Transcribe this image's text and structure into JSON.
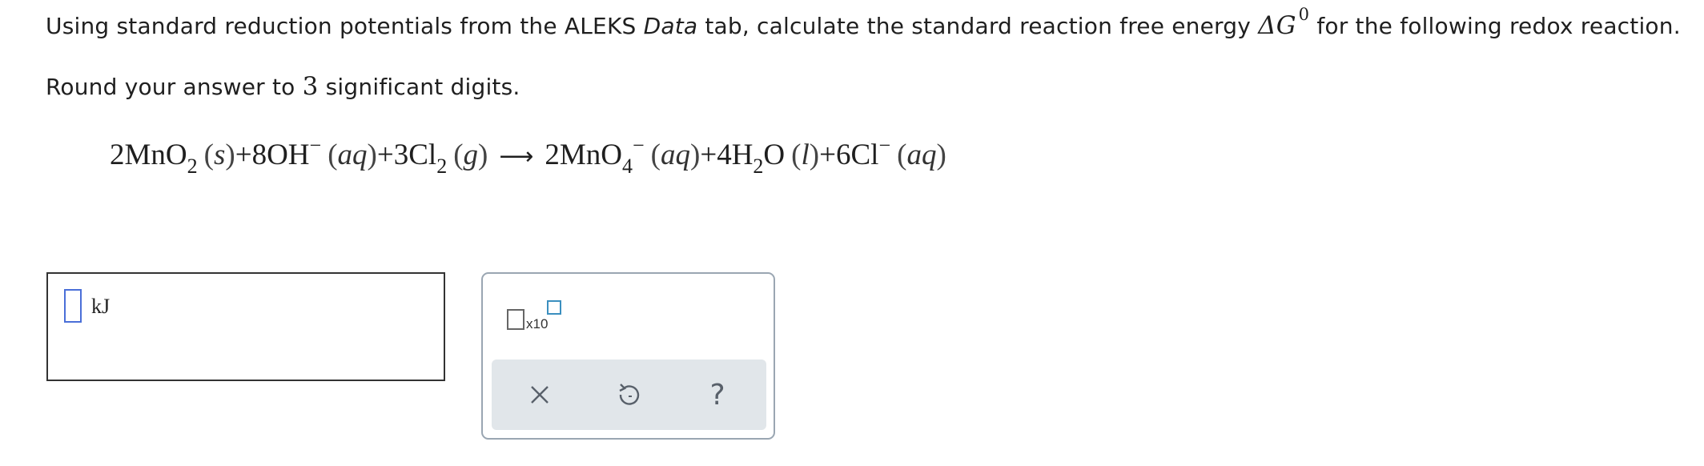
{
  "question": {
    "line1_part1": "Using standard reduction potentials from the ALEKS ",
    "line1_italic": "Data",
    "line1_part2": " tab, calculate the standard reaction free energy ",
    "delta_g_symbol": "ΔG",
    "delta_g_superscript": "0",
    "line1_part3": " for the following redox reaction.",
    "line2_part1": "Round your answer to ",
    "line2_number": "3",
    "line2_part2": " significant digits."
  },
  "equation": {
    "reactants": [
      {
        "coef": "2",
        "formula": "MnO",
        "sub": "2",
        "sup": "",
        "phase": "s"
      },
      {
        "coef": "8",
        "formula": "OH",
        "sub": "",
        "sup": "−",
        "phase": "aq"
      },
      {
        "coef": "3",
        "formula": "Cl",
        "sub": "2",
        "sup": "",
        "phase": "g"
      }
    ],
    "arrow": "⟶",
    "products": [
      {
        "coef": "2",
        "formula": "MnO",
        "sub": "4",
        "sup": "−",
        "phase": "aq"
      },
      {
        "coef": "4",
        "formula": "H",
        "sub": "2",
        "formula2": "O",
        "sup": "",
        "phase": "l"
      },
      {
        "coef": "6",
        "formula": "Cl",
        "sub": "",
        "sup": "−",
        "phase": "aq"
      }
    ],
    "plus": "+"
  },
  "answer": {
    "value": "",
    "unit": "kJ"
  },
  "tools": {
    "sci_notation_label": "x10",
    "clear_icon": "close-icon",
    "undo_icon": "undo-icon",
    "help_label": "?"
  },
  "colors": {
    "input_border": "#4a6fd8",
    "exponent_box_border": "#3b8fbf",
    "action_bar_bg": "#e1e6ea",
    "icon_color": "#58606a"
  }
}
